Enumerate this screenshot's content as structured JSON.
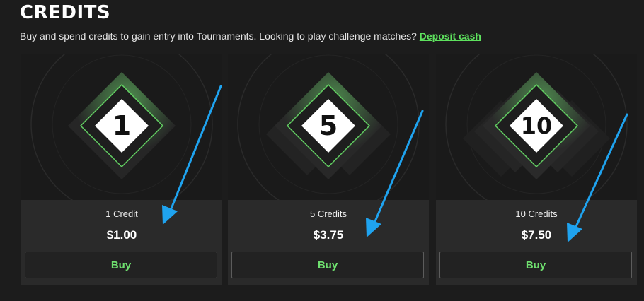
{
  "header": {
    "title": "CREDITS",
    "subtitle": "Buy and spend credits to gain entry into Tournaments. Looking to play challenge matches?",
    "link_label": "Deposit cash"
  },
  "cards": [
    {
      "number": "1",
      "name": "1 Credit",
      "price": "$1.00",
      "buy_label": "Buy"
    },
    {
      "number": "5",
      "name": "5 Credits",
      "price": "$3.75",
      "buy_label": "Buy"
    },
    {
      "number": "10",
      "name": "10 Credits",
      "price": "$7.50",
      "buy_label": "Buy"
    }
  ],
  "colors": {
    "accent_green": "#6fe06f",
    "annotation_arrow": "#1fa3ef",
    "background": "#1c1c1c"
  }
}
